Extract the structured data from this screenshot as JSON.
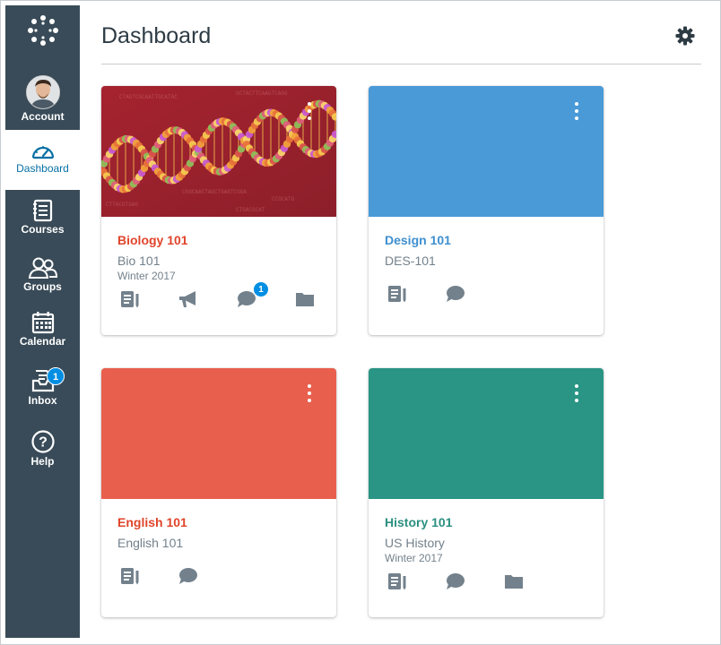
{
  "nav": {
    "account_label": "Account",
    "dashboard_label": "Dashboard",
    "courses_label": "Courses",
    "groups_label": "Groups",
    "calendar_label": "Calendar",
    "inbox_label": "Inbox",
    "inbox_badge": "1",
    "help_label": "Help",
    "help_glyph": "?",
    "colors": {
      "background": "#394b58",
      "active": "#0770a3"
    }
  },
  "header": {
    "title": "Dashboard",
    "settings_icon": "gear-icon"
  },
  "cards": [
    {
      "title": "Biology 101",
      "code": "Bio 101",
      "term": "Winter 2017",
      "color": "#e0442b",
      "hero": "dna-image",
      "discussion_badge": "1"
    },
    {
      "title": "Design 101",
      "code": "DES-101",
      "term": "",
      "color": "#3e8fcf",
      "hero_color": "#4a9ad8"
    },
    {
      "title": "English 101",
      "code": "English 101",
      "term": "",
      "color": "#e0442b",
      "hero_color": "#e8604d"
    },
    {
      "title": "History 101",
      "code": "US History",
      "term": "Winter 2017",
      "color": "#2a8f80",
      "hero_color": "#2a9584"
    }
  ]
}
